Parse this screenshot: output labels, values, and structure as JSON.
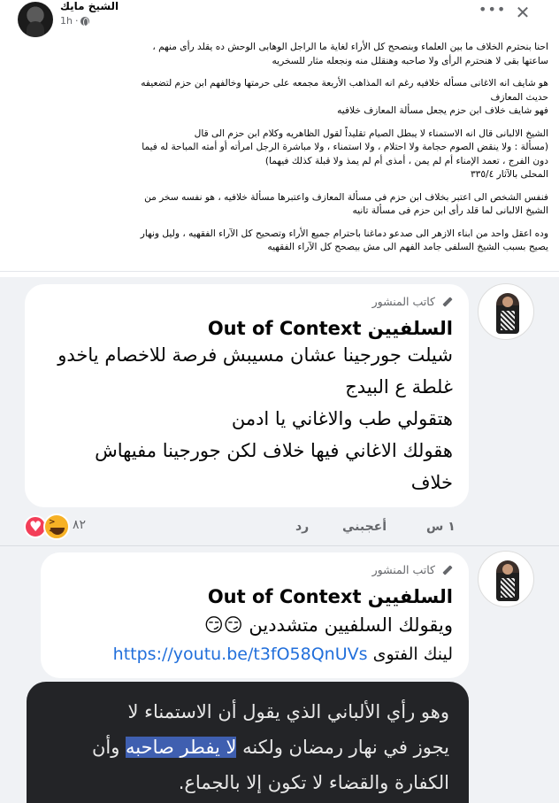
{
  "post": {
    "author": "الشيخ مايك",
    "time": "1h",
    "more_icon": "more-dots-icon",
    "close_icon": "close-icon",
    "paragraphs": [
      "احنا بنحترم الخلاف ما بين العلماء وبنصحح كل الأراء لغاية ما الراجل الوهابى الوحش ده يقلد رأى منهم ،\nساعتها بقى لا هنحترم الرأى ولا صاحبه وهنقلل منه ونجعله مثار للسخريه",
      "هو شايف انه الاغانى مسأله خلافيه رغم انه المذاهب الأربعة مجمعه على حرمتها وخالفهم ابن حزم لتضعيفه\nحديث المعازف\nفهو شايف خلاف ابن حزم يجعل مسألة المعازف خلافيه",
      "الشيخ الالبانى قال انه الاستمناء لا يبطل الصيام تقليداً لقول الظاهريه وكلام ابن حزم الى قال\n(مسألة : ولا ينقض الصوم حجامة ولا احتلام ، ولا استمناء ، ولا مباشرة الرجل امرأته أو أمته المباحة له فيما\nدون الفرج ، تعمد الإمناء أم لم يمن ، أمذى أم لم يمذ ولا قبلة كذلك فيهما)\nالمحلى بالآثار ٣٣٥/٤",
      "فنفس الشخص الى اعتبر بخلاف ابن حزم فى مسألة المعازف واعتبرها مسألة خلافيه ، هو نفسه سخر من\nالشيخ الالبانى لما قلد رأى ابن حزم فى مسألة تانيه",
      "وده اعقل واحد من ابناء الازهر الى صدعو دماغنا باحترام جميع الأراء وتصحيح كل الآراء الفقهيه ، وليل ونهار\nيصيح بسبب الشيخ السلفى جامد الفهم الى مش بيصحح كل الآراء الفقهيه"
    ]
  },
  "comments": [
    {
      "badge": "كاتب المنشور",
      "title": "السلفيين Out of Context",
      "lines": [
        "شيلت جورجينا عشان مسيبش فرصة للاخصام ياخدو",
        "غلطة ع البيدج",
        "هتقولي طب والاغاني يا ادمن",
        "هقولك الاغاني فيها خلاف لكن جورجينا مفيهاش",
        "خلاف"
      ],
      "actions": {
        "time": "١ س",
        "like": "أعجبني",
        "reply": "رد"
      },
      "reaction_count": "٨٢",
      "reactions": [
        "haha-icon",
        "heart-icon"
      ]
    },
    {
      "badge": "كاتب المنشور",
      "title": "السلفيين Out of Context",
      "line1": "ويقولك السلفيين متشددين 😏😏",
      "link_label": "لينك الفتوى",
      "link_url": "https://youtu.be/t3fO58QnUVs",
      "image_text": {
        "line1": "وهو رأي الألباني الذي يقول أن الاستمناء لا",
        "line2_pre": "يجوز في نهار رمضان ولكنه ",
        "line2_hl": "لا يفطر صاحبه",
        "line2_post": " وأن",
        "line3": "الكفارة والقضاء لا تكون إلا بالجماع."
      }
    }
  ]
}
